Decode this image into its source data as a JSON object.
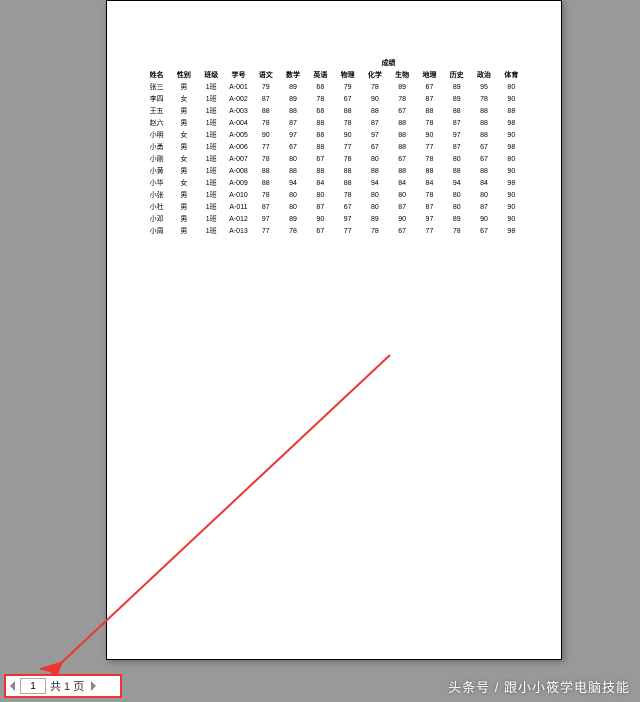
{
  "table": {
    "merged_header": "成绩",
    "headers": [
      "姓名",
      "性别",
      "班级",
      "学号",
      "语文",
      "数学",
      "英语",
      "物理",
      "化学",
      "生物",
      "地理",
      "历史",
      "政治",
      "体育"
    ],
    "rows": [
      [
        "张三",
        "男",
        "1班",
        "A-001",
        "79",
        "89",
        "68",
        "79",
        "78",
        "89",
        "67",
        "89",
        "95",
        "80"
      ],
      [
        "李四",
        "女",
        "1班",
        "A-002",
        "87",
        "89",
        "78",
        "67",
        "90",
        "78",
        "87",
        "89",
        "78",
        "90"
      ],
      [
        "王五",
        "男",
        "1班",
        "A-003",
        "88",
        "88",
        "68",
        "88",
        "88",
        "67",
        "88",
        "88",
        "88",
        "88"
      ],
      [
        "赵六",
        "男",
        "1班",
        "A-004",
        "78",
        "87",
        "88",
        "78",
        "87",
        "88",
        "78",
        "87",
        "88",
        "98"
      ],
      [
        "小明",
        "女",
        "1班",
        "A-005",
        "90",
        "97",
        "88",
        "90",
        "97",
        "88",
        "90",
        "97",
        "88",
        "90"
      ],
      [
        "小勇",
        "男",
        "1班",
        "A-006",
        "77",
        "67",
        "88",
        "77",
        "67",
        "88",
        "77",
        "87",
        "67",
        "98"
      ],
      [
        "小刚",
        "女",
        "1班",
        "A-007",
        "78",
        "80",
        "67",
        "78",
        "80",
        "67",
        "78",
        "80",
        "67",
        "80"
      ],
      [
        "小黄",
        "男",
        "1班",
        "A-008",
        "88",
        "88",
        "88",
        "88",
        "88",
        "88",
        "88",
        "88",
        "88",
        "90"
      ],
      [
        "小华",
        "女",
        "1班",
        "A-009",
        "88",
        "94",
        "84",
        "88",
        "94",
        "84",
        "84",
        "94",
        "84",
        "98"
      ],
      [
        "小张",
        "男",
        "1班",
        "A-010",
        "78",
        "80",
        "80",
        "78",
        "80",
        "80",
        "78",
        "80",
        "80",
        "90"
      ],
      [
        "小杜",
        "男",
        "1班",
        "A-011",
        "87",
        "80",
        "87",
        "67",
        "80",
        "87",
        "87",
        "80",
        "87",
        "90"
      ],
      [
        "小邓",
        "男",
        "1班",
        "A-012",
        "97",
        "89",
        "90",
        "97",
        "89",
        "90",
        "97",
        "89",
        "90",
        "90"
      ],
      [
        "小周",
        "男",
        "1班",
        "A-013",
        "77",
        "78",
        "67",
        "77",
        "78",
        "67",
        "77",
        "78",
        "67",
        "98"
      ]
    ]
  },
  "pager": {
    "current": "1",
    "total_text": "共 1 页"
  },
  "watermark": "头条号 / 跟小小筱学电脑技能"
}
